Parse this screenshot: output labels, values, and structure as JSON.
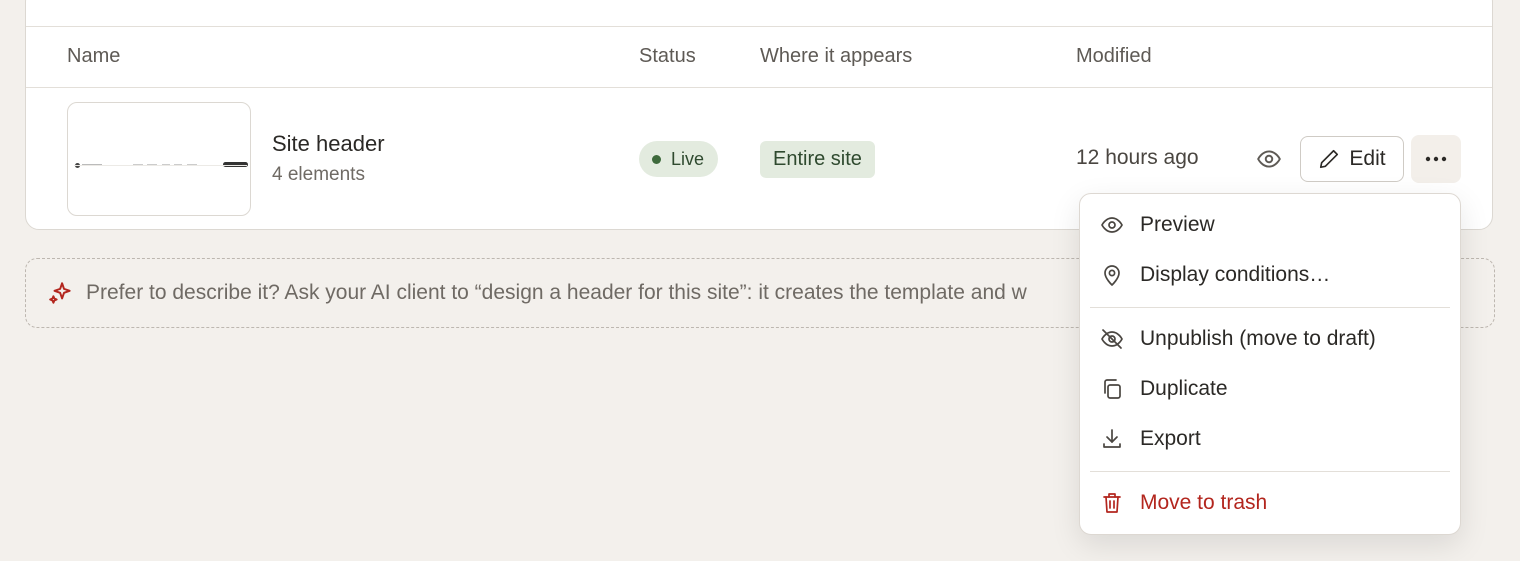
{
  "table": {
    "headers": {
      "name": "Name",
      "status": "Status",
      "where": "Where it appears",
      "modified": "Modified"
    },
    "row": {
      "title": "Site header",
      "subtitle": "4 elements",
      "status": "Live",
      "where": "Entire site",
      "modified": "12 hours ago",
      "edit_label": "Edit"
    }
  },
  "hint": {
    "text": "Prefer to describe it? Ask your AI client to “design a header for this site”: it creates the template and w"
  },
  "menu": {
    "items": [
      {
        "label": "Preview",
        "icon": "eye-icon"
      },
      {
        "label": "Display conditions…",
        "icon": "map-pin-icon"
      },
      {
        "label": "Unpublish (move to draft)",
        "icon": "eye-off-icon"
      },
      {
        "label": "Duplicate",
        "icon": "copy-icon"
      },
      {
        "label": "Export",
        "icon": "download-icon"
      },
      {
        "label": "Move to trash",
        "icon": "trash-icon"
      }
    ]
  },
  "colors": {
    "background": "#f3f0ec",
    "badge_bg": "#e3ebdf",
    "badge_text": "#2f4a2f",
    "danger": "#b3261e",
    "spark": "#b3261e"
  }
}
